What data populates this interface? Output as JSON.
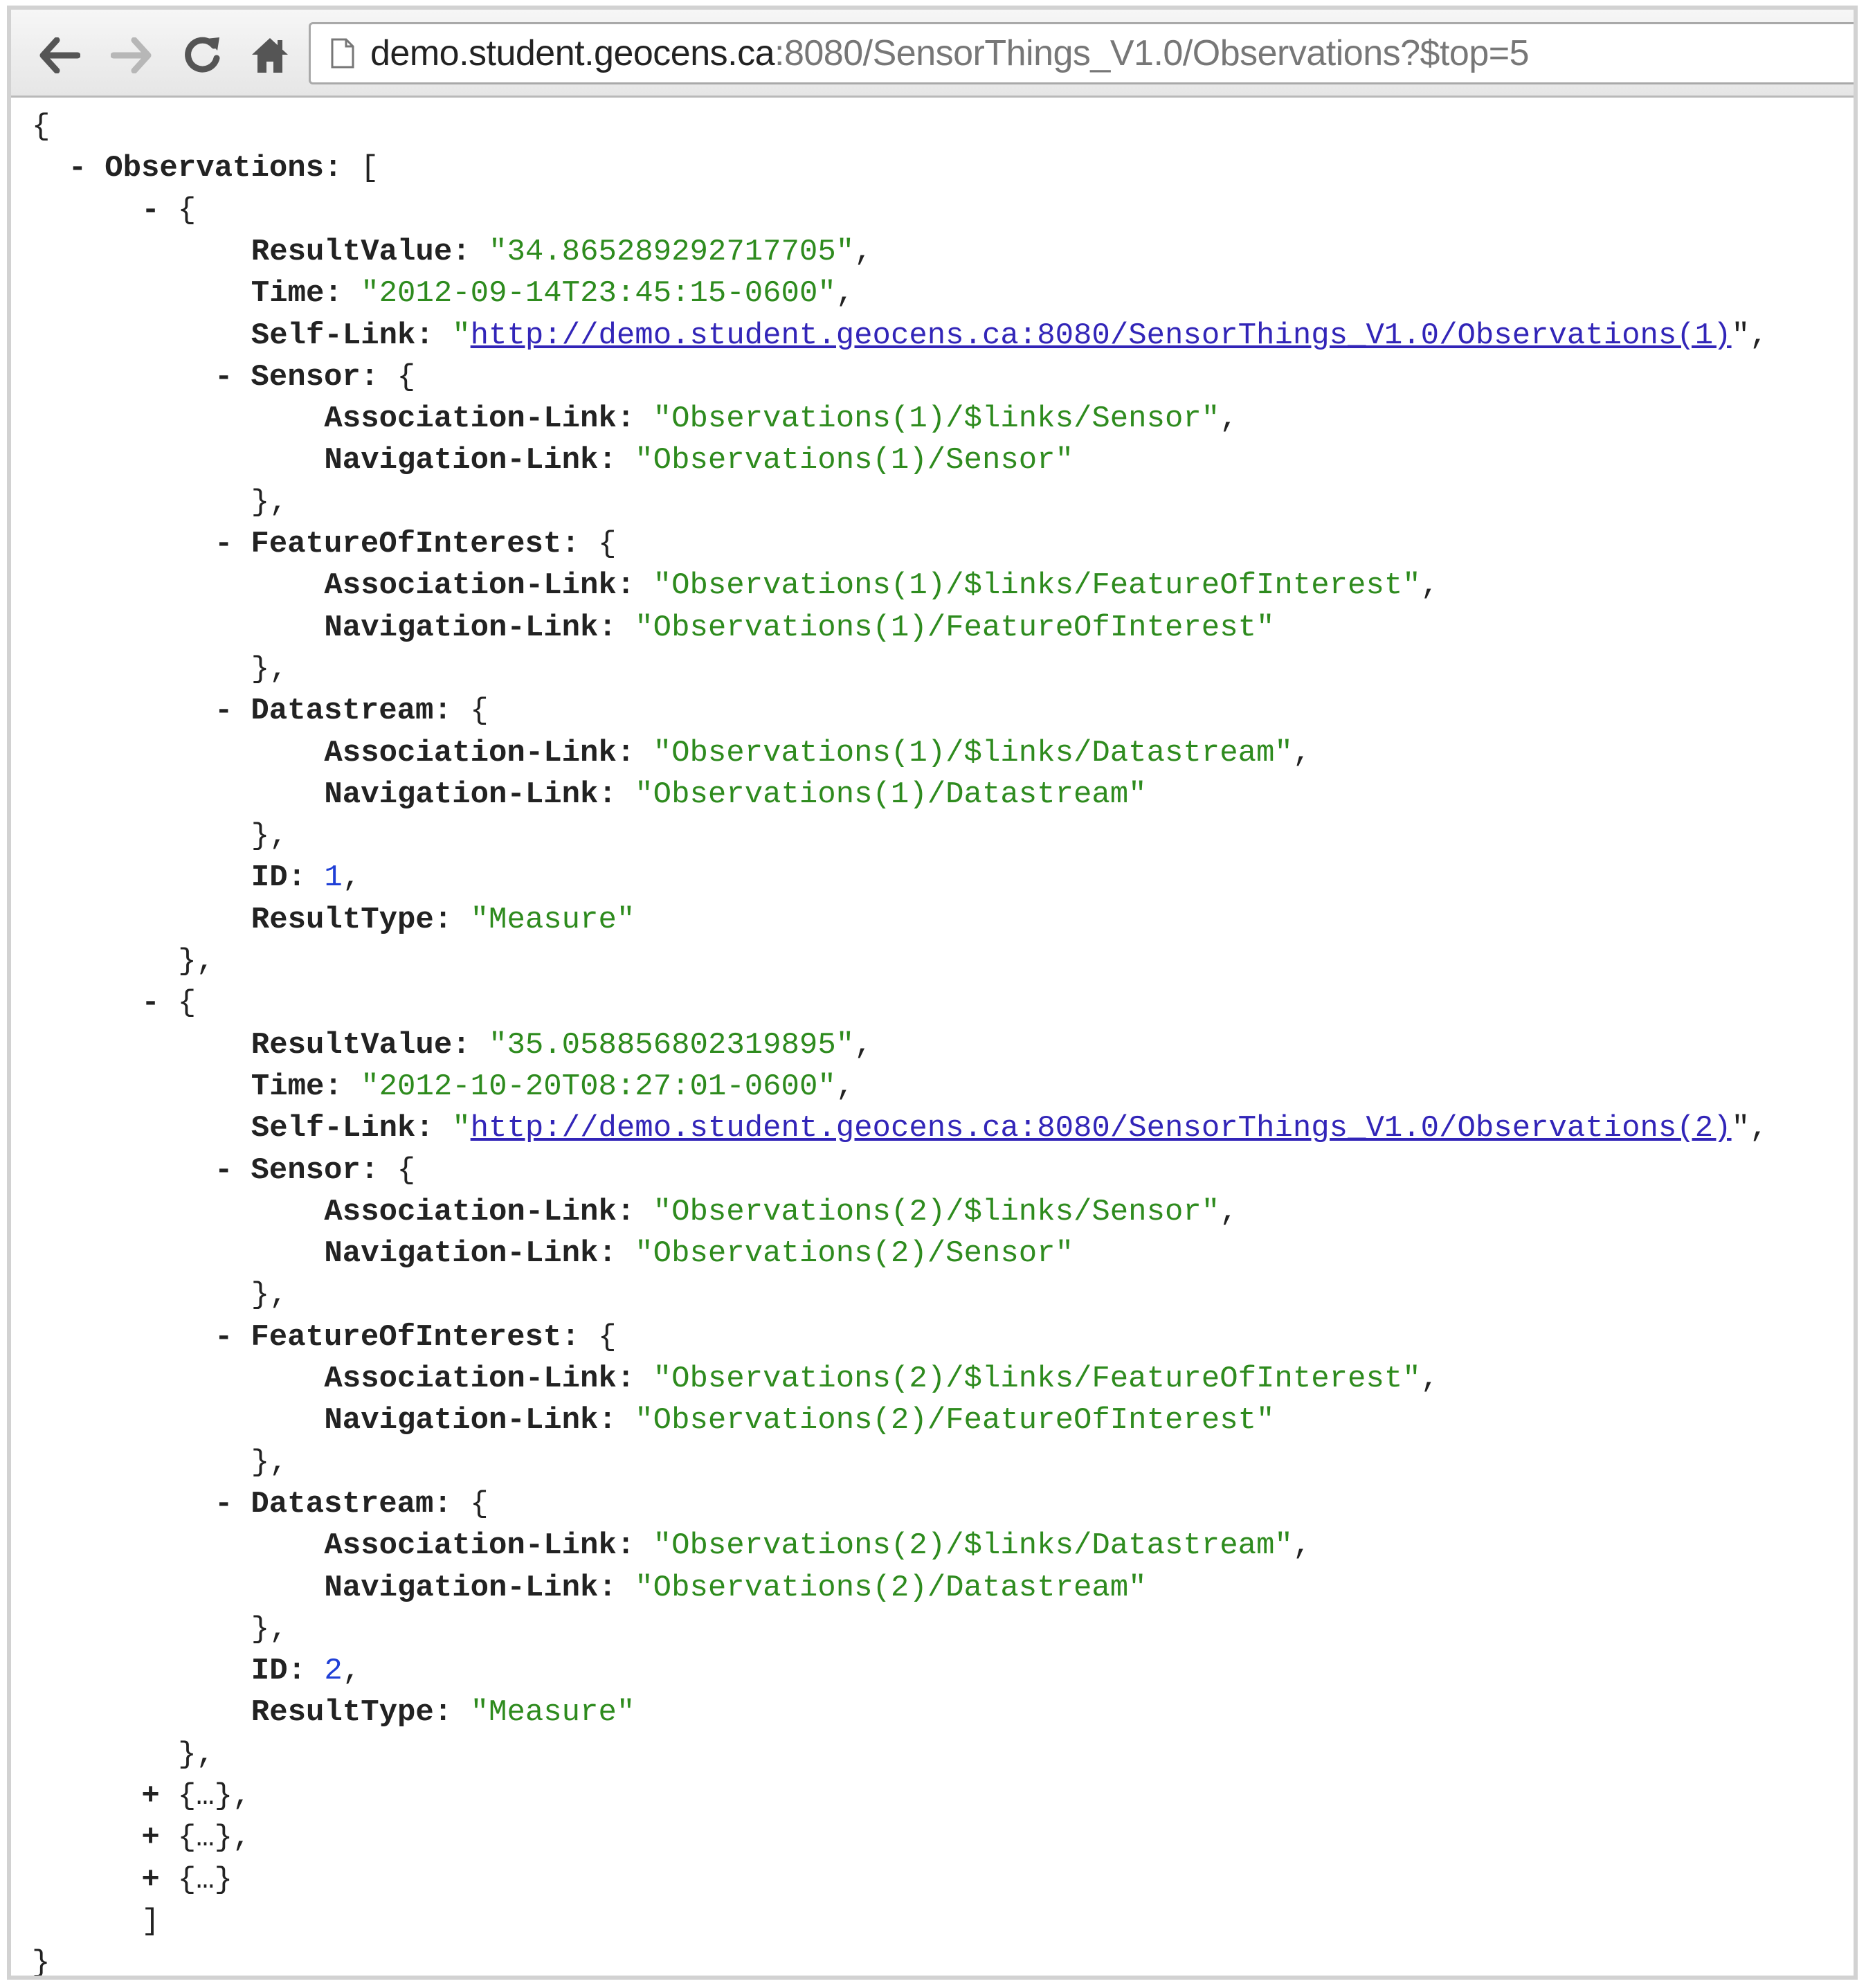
{
  "browser": {
    "url_host": "demo.student.geocens.ca",
    "url_rest": ":8080/SensorThings_V1.0/Observations?$top=5"
  },
  "json_view": {
    "root_open": "{",
    "root_close": "}",
    "array_key": "Observations:",
    "array_open": "[",
    "array_close": "]",
    "collapsed_items": [
      "{…},",
      "{…},",
      "{…}"
    ],
    "observations": [
      {
        "result_value": "\"34.865289292717705\"",
        "time": "\"2012-09-14T23:45:15-0600\"",
        "self_link": "http://demo.student.geocens.ca:8080/SensorThings_V1.0/Observations(1)",
        "sensor": {
          "association": "\"Observations(1)/$links/Sensor\"",
          "navigation": "\"Observations(1)/Sensor\""
        },
        "feature_of_interest": {
          "association": "\"Observations(1)/$links/FeatureOfInterest\"",
          "navigation": "\"Observations(1)/FeatureOfInterest\""
        },
        "datastream": {
          "association": "\"Observations(1)/$links/Datastream\"",
          "navigation": "\"Observations(1)/Datastream\""
        },
        "id": "1",
        "result_type": "\"Measure\""
      },
      {
        "result_value": "\"35.058856802319895\"",
        "time": "\"2012-10-20T08:27:01-0600\"",
        "self_link": "http://demo.student.geocens.ca:8080/SensorThings_V1.0/Observations(2)",
        "sensor": {
          "association": "\"Observations(2)/$links/Sensor\"",
          "navigation": "\"Observations(2)/Sensor\""
        },
        "feature_of_interest": {
          "association": "\"Observations(2)/$links/FeatureOfInterest\"",
          "navigation": "\"Observations(2)/FeatureOfInterest\""
        },
        "datastream": {
          "association": "\"Observations(2)/$links/Datastream\"",
          "navigation": "\"Observations(2)/Datastream\""
        },
        "id": "2",
        "result_type": "\"Measure\""
      }
    ]
  },
  "labels": {
    "result_value": "ResultValue:",
    "time": "Time:",
    "self_link": "Self-Link:",
    "sensor": "Sensor:",
    "feature_of_interest": "FeatureOfInterest:",
    "datastream": "Datastream:",
    "association_link": "Association-Link:",
    "navigation_link": "Navigation-Link:",
    "id": "ID:",
    "result_type": "ResultType:",
    "toggle_expanded": "-",
    "toggle_collapsed": "+",
    "open_brace": "{",
    "close_brace_comma": "},"
  },
  "icons": {
    "back": "arrow-left-icon",
    "forward": "arrow-right-icon",
    "reload": "reload-icon",
    "home": "home-icon",
    "page": "page-icon"
  }
}
